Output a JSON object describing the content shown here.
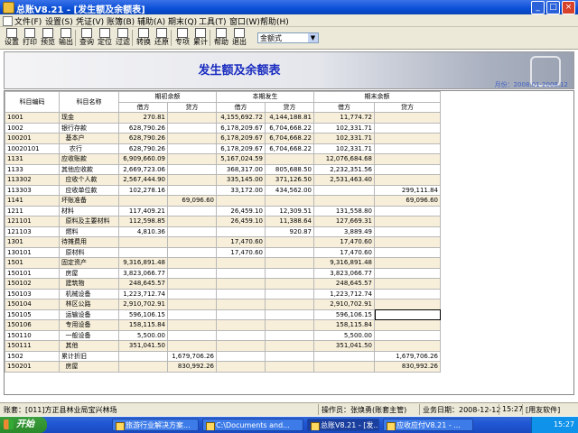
{
  "window": {
    "title": "总账V8.21 - [发生额及余额表]"
  },
  "menu": [
    "文件(F)",
    "设置(S)",
    "凭证(V)",
    "账簿(B)",
    "辅助(A)",
    "期末(Q)",
    "工具(T)",
    "窗口(W)",
    "帮助(H)"
  ],
  "toolbar": {
    "buttons": [
      {
        "label": "设置",
        "icon": "settings-icon"
      },
      {
        "label": "打印",
        "icon": "printer-icon"
      },
      {
        "label": "预览",
        "icon": "preview-icon"
      },
      {
        "label": "输出",
        "icon": "export-icon"
      },
      {
        "label": "查询",
        "icon": "search-icon"
      },
      {
        "label": "定位",
        "icon": "locate-icon"
      },
      {
        "label": "过滤",
        "icon": "filter-icon"
      },
      {
        "label": "转换",
        "icon": "convert-icon"
      },
      {
        "label": "还原",
        "icon": "restore-icon"
      },
      {
        "label": "专项",
        "icon": "special-icon"
      },
      {
        "label": "累计",
        "icon": "sigma-icon"
      },
      {
        "label": "帮助",
        "icon": "help-icon"
      },
      {
        "label": "退出",
        "icon": "exit-icon"
      }
    ],
    "format_select": "金额式"
  },
  "report": {
    "title": "发生额及余额表",
    "month": "月份：2008.01-2008.12"
  },
  "table": {
    "headers": {
      "code": "科目编码",
      "name": "科目名称",
      "opening": "期初余额",
      "period": "本期发生",
      "closing": "期末余额",
      "debit": "借方",
      "credit": "贷方"
    },
    "rows": [
      [
        "1001",
        "现金",
        "270.81",
        "",
        "4,155,692.72",
        "4,144,188.81",
        "11,774.72",
        ""
      ],
      [
        "1002",
        "银行存款",
        "628,790.26",
        "",
        "6,178,209.67",
        "6,704,668.22",
        "102,331.71",
        ""
      ],
      [
        "100201",
        "  基本户",
        "628,790.26",
        "",
        "6,178,209.67",
        "6,704,668.22",
        "102,331.71",
        ""
      ],
      [
        "10020101",
        "    农行",
        "628,790.26",
        "",
        "6,178,209.67",
        "6,704,668.22",
        "102,331.71",
        ""
      ],
      [
        "1131",
        "应收账款",
        "6,909,660.09",
        "",
        "5,167,024.59",
        "",
        "12,076,684.68",
        ""
      ],
      [
        "1133",
        "其他应收款",
        "2,669,723.06",
        "",
        "368,317.00",
        "805,688.50",
        "2,232,351.56",
        ""
      ],
      [
        "113302",
        "  应收个人款",
        "2,567,444.90",
        "",
        "335,145.00",
        "371,126.50",
        "2,531,463.40",
        ""
      ],
      [
        "113303",
        "  应收单位款",
        "102,278.16",
        "",
        "33,172.00",
        "434,562.00",
        "",
        "299,111.84"
      ],
      [
        "1141",
        "坏账准备",
        "",
        "69,096.60",
        "",
        "",
        "",
        "69,096.60"
      ],
      [
        "1211",
        "材料",
        "117,409.21",
        "",
        "26,459.10",
        "12,309.51",
        "131,558.80",
        ""
      ],
      [
        "121101",
        "  原料及主要材料",
        "112,598.85",
        "",
        "26,459.10",
        "11,388.64",
        "127,669.31",
        ""
      ],
      [
        "121103",
        "  燃料",
        "4,810.36",
        "",
        "",
        "920.87",
        "3,889.49",
        ""
      ],
      [
        "1301",
        "待摊费用",
        "",
        "",
        "17,470.60",
        "",
        "17,470.60",
        ""
      ],
      [
        "130101",
        "  原材料",
        "",
        "",
        "17,470.60",
        "",
        "17,470.60",
        ""
      ],
      [
        "1501",
        "固定资产",
        "9,316,891.48",
        "",
        "",
        "",
        "9,316,891.48",
        ""
      ],
      [
        "150101",
        "  房屋",
        "3,823,066.77",
        "",
        "",
        "",
        "3,823,066.77",
        ""
      ],
      [
        "150102",
        "  建筑物",
        "248,645.57",
        "",
        "",
        "",
        "248,645.57",
        ""
      ],
      [
        "150103",
        "  机械设备",
        "1,223,712.74",
        "",
        "",
        "",
        "1,223,712.74",
        ""
      ],
      [
        "150104",
        "  林区公路",
        "2,910,702.91",
        "",
        "",
        "",
        "2,910,702.91",
        ""
      ],
      [
        "150105",
        "  运输设备",
        "596,106.15",
        "",
        "",
        "",
        "596,106.15",
        ""
      ],
      [
        "150106",
        "  专用设备",
        "158,115.84",
        "",
        "",
        "",
        "158,115.84",
        ""
      ],
      [
        "150110",
        "  一般设备",
        "5,500.00",
        "",
        "",
        "",
        "5,500.00",
        ""
      ],
      [
        "150111",
        "  其他",
        "351,041.50",
        "",
        "",
        "",
        "351,041.50",
        ""
      ],
      [
        "1502",
        "累计折旧",
        "",
        "1,679,706.26",
        "",
        "",
        "",
        "1,679,706.26"
      ],
      [
        "150201",
        "  房屋",
        "",
        "830,992.26",
        "",
        "",
        "",
        "830,992.26"
      ]
    ]
  },
  "status": {
    "account": "账套：[011]方正县林业局宝兴林场",
    "operator": "操作员：张焕勇(账套主管)",
    "business_date": "业务日期：2008-12-12",
    "time": "15:27",
    "brand": "[用友软件]"
  },
  "taskbar": {
    "start": "开始",
    "tasks": [
      "旅游行业解决方案...",
      "C:\\Documents and...",
      "总账V8.21 - [发...",
      "应收应付V8.21 - ..."
    ],
    "clock": "15:27"
  }
}
